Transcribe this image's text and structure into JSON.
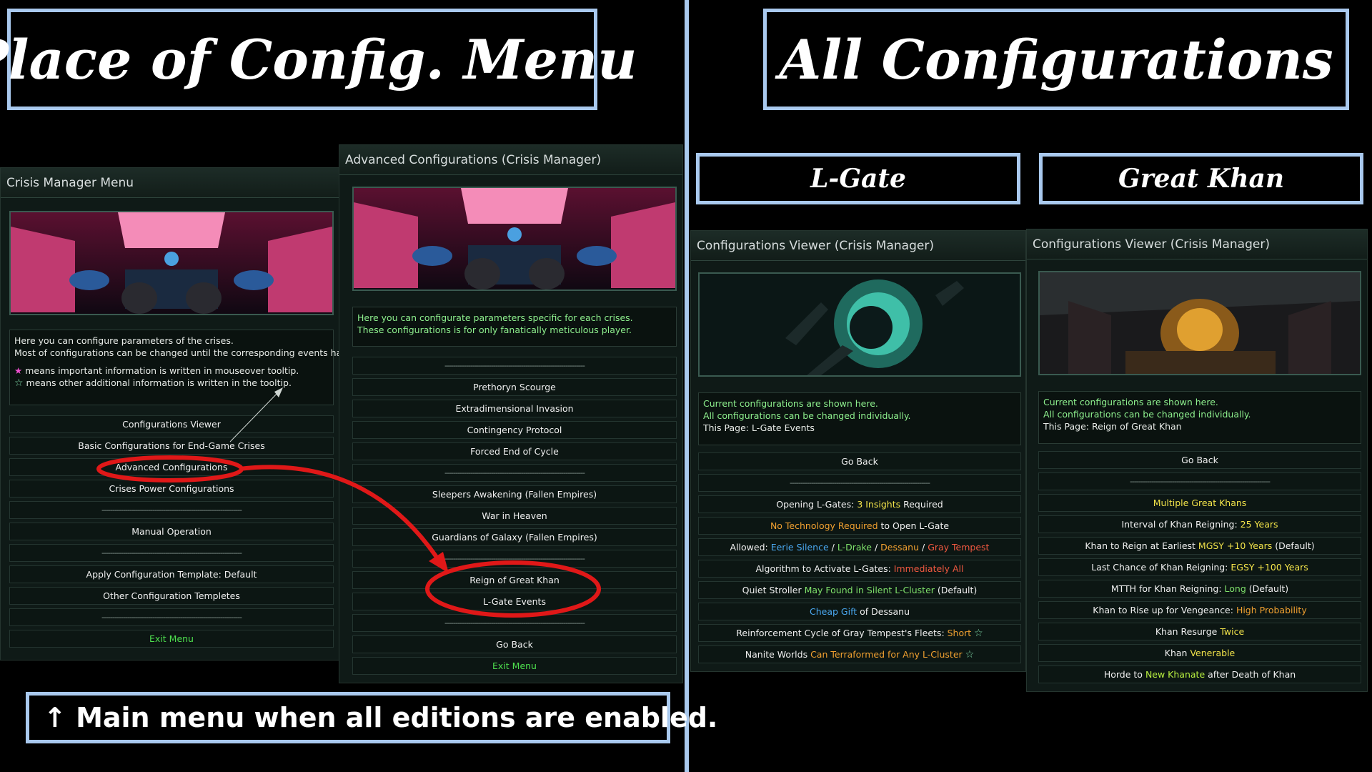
{
  "left_title": "Place of Config. Menu",
  "right_title": "All Configurations",
  "note": "↑ Main menu when all editions are enabled.",
  "headers": {
    "lgate": "L-Gate",
    "khan": "Great Khan"
  },
  "crisis_menu": {
    "title": "Crisis Manager Menu",
    "desc": [
      "Here you can configure parameters of the crises.",
      "Most of configurations can be changed until the corresponding events happen."
    ],
    "legend_important": "means important information is written in mouseover tooltip.",
    "legend_other": "means other additional information is written in the tooltip.",
    "items": [
      "Configurations Viewer",
      "Basic Configurations for End-Game Crises",
      "Advanced Configurations",
      "Crises Power Configurations",
      "------------------------------------------------------------------",
      "Manual Operation",
      "------------------------------------------------------------------",
      "Apply Configuration Template: Default",
      "Other Configuration Templetes",
      "------------------------------------------------------------------",
      "Exit Menu"
    ]
  },
  "advanced": {
    "title": "Advanced Configurations (Crisis Manager)",
    "desc": [
      "Here you can configurate parameters specific for each crises.",
      "These configurations is for only fanatically meticulous player."
    ],
    "items": [
      "------------------------------------------------------------------",
      "Prethoryn Scourge",
      "Extradimensional Invasion",
      "Contingency Protocol",
      "Forced End of Cycle",
      "------------------------------------------------------------------",
      "Sleepers Awakening  (Fallen Empires)",
      "War in Heaven",
      "Guardians of Galaxy (Fallen Empires)",
      "------------------------------------------------------------------",
      "Reign of Great Khan",
      "L-Gate Events",
      "------------------------------------------------------------------",
      "Go Back",
      "Exit Menu"
    ]
  },
  "lgate_viewer": {
    "title": "Configurations Viewer (Crisis Manager)",
    "desc": [
      "Current configurations are shown here.",
      "All configurations can be changed individually.",
      "This Page: L-Gate Events"
    ],
    "go_back": "Go Back",
    "dash": "------------------------------------------------------------------",
    "r1": [
      "Opening L-Gates: ",
      "3 Insights",
      " Required"
    ],
    "r2": [
      "No Technology Required",
      " to Open L-Gate"
    ],
    "r3": [
      "Allowed: ",
      "Eerie Silence",
      " / ",
      "L-Drake",
      " / ",
      "Dessanu",
      " / ",
      "Gray Tempest"
    ],
    "r4": [
      "Algorithm to Activate L-Gates: ",
      "Immediately All"
    ],
    "r5": [
      "Quiet Stroller ",
      "May Found in Silent L-Cluster",
      " (Default)"
    ],
    "r6": [
      "Cheap Gift",
      " of Dessanu"
    ],
    "r7": [
      "Reinforcement Cycle of Gray Tempest's Fleets: ",
      "Short"
    ],
    "r8": [
      "Nanite Worlds ",
      "Can Terraformed for Any L-Cluster"
    ]
  },
  "khan_viewer": {
    "title": "Configurations Viewer (Crisis Manager)",
    "desc": [
      "Current configurations are shown here.",
      "All configurations can be changed individually.",
      "This Page: Reign of Great Khan"
    ],
    "go_back": "Go Back",
    "dash": "------------------------------------------------------------------",
    "r1": [
      "Multiple Great Khans"
    ],
    "r2": [
      "Interval of Khan Reigning: ",
      "25 Years"
    ],
    "r3": [
      "Khan to Reign at Earliest ",
      "MGSY +10 Years",
      " (Default)"
    ],
    "r4": [
      "Last Chance of Khan Reigning: ",
      "EGSY +100 Years"
    ],
    "r5": [
      "MTTH for Khan Reigning: ",
      "Long",
      " (Default)"
    ],
    "r6": [
      "Khan to Rise up for Vengeance: ",
      "High Probability"
    ],
    "r7": [
      "Khan Resurge ",
      "Twice"
    ],
    "r8": [
      "Khan ",
      "Venerable"
    ],
    "r9": [
      "Horde to ",
      "New Khanate",
      " after Death of Khan"
    ]
  }
}
